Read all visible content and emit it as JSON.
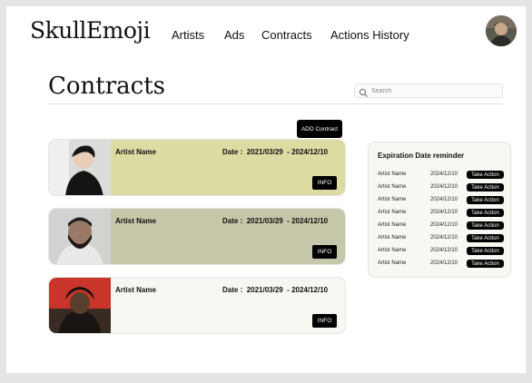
{
  "brand": {
    "logo": "SkullEmoji"
  },
  "nav": {
    "items": [
      "Artists",
      "Ads",
      "Contracts",
      "Actions History"
    ]
  },
  "page": {
    "title": "Contracts"
  },
  "search": {
    "placeholder": "Search"
  },
  "toolbar": {
    "add_label": "ADD Contract"
  },
  "contracts": [
    {
      "artist": "Artist Name",
      "date_label": "Date :",
      "start": "2021/03/29",
      "end": "2024/12/10",
      "info_label": "INFO",
      "color": "#dcdba2"
    },
    {
      "artist": "Artist Name",
      "date_label": "Date :",
      "start": "2021/03/29",
      "end": "2024/12/10",
      "info_label": "INFO",
      "color": "#c6c6a8"
    },
    {
      "artist": "Artist Name",
      "date_label": "Date :",
      "start": "2021/03/29",
      "end": "2024/12/10",
      "info_label": "INFO",
      "color": "#f7f7f1"
    }
  ],
  "reminder": {
    "title": "Expiration Date reminder",
    "rows": [
      {
        "name": "Artist Name",
        "date": "2024/12/10",
        "action": "Take Action"
      },
      {
        "name": "Artist Name",
        "date": "2024/12/10",
        "action": "Take Action"
      },
      {
        "name": "Artist Name",
        "date": "2024/12/10",
        "action": "Take Action"
      },
      {
        "name": "Artist Name",
        "date": "2024/12/10",
        "action": "Take Action"
      },
      {
        "name": "Artist Name",
        "date": "2024/12/10",
        "action": "Take Action"
      },
      {
        "name": "Artist Name",
        "date": "2024/12/10",
        "action": "Take Action"
      },
      {
        "name": "Artist Name",
        "date": "2024/12/10",
        "action": "Take Action"
      },
      {
        "name": "Artist Name",
        "date": "2024/12/10",
        "action": "Take Action"
      }
    ]
  }
}
